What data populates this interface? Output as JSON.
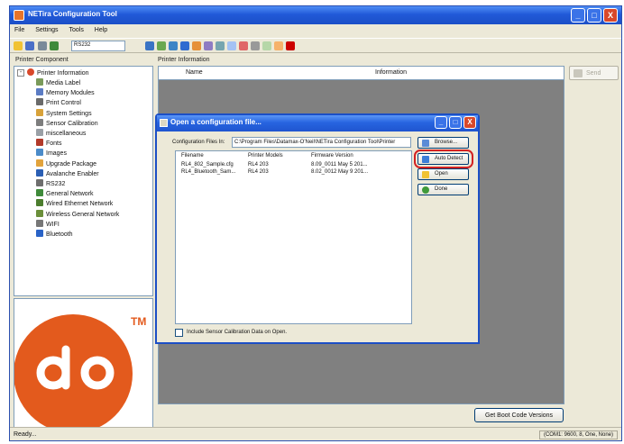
{
  "window": {
    "title": "NETira Configuration Tool",
    "min_glyph": "_",
    "max_glyph": "□",
    "close_glyph": "X"
  },
  "menu": [
    "File",
    "Settings",
    "Tools",
    "Help"
  ],
  "toolbar": {
    "port_value": "RS232"
  },
  "left_panel": {
    "label": "Printer Component",
    "tree_root": "Printer Information",
    "tree_items": [
      {
        "label": "Media Label",
        "icon": "media-label-icon",
        "color": "#7a9a5a"
      },
      {
        "label": "Memory Modules",
        "icon": "memory-icon",
        "color": "#5b7cc4"
      },
      {
        "label": "Print Control",
        "icon": "print-control-icon",
        "color": "#6a6a6a"
      },
      {
        "label": "System Settings",
        "icon": "wrench-icon",
        "color": "#d8a23a"
      },
      {
        "label": "Sensor Calibration",
        "icon": "sensor-icon",
        "color": "#7d7d7d"
      },
      {
        "label": "miscellaneous",
        "icon": "misc-icon",
        "color": "#9aa0a6"
      },
      {
        "label": "Fonts",
        "icon": "font-icon",
        "color": "#b23a2a"
      },
      {
        "label": "Images",
        "icon": "image-icon",
        "color": "#4b8bc9"
      },
      {
        "label": "Upgrade Package",
        "icon": "package-icon",
        "color": "#e2a33c"
      },
      {
        "label": "Avalanche Enabler",
        "icon": "avalanche-icon",
        "color": "#2b5fb4"
      },
      {
        "label": "RS232",
        "icon": "serial-icon",
        "color": "#6e6e6e"
      },
      {
        "label": "General Network",
        "icon": "network-icon",
        "color": "#3f8a3a"
      },
      {
        "label": "Wired Ethernet Network",
        "icon": "ethernet-icon",
        "color": "#4c7d2e"
      },
      {
        "label": "Wireless General Network",
        "icon": "wireless-icon",
        "color": "#6b8f3a"
      },
      {
        "label": "WIFI",
        "icon": "wifi-icon",
        "color": "#777777"
      },
      {
        "label": "Bluetooth",
        "icon": "bluetooth-icon",
        "color": "#2a63c7"
      }
    ],
    "logo_tm": "TM",
    "logo_color": "#e35a1d"
  },
  "right_panel": {
    "label": "Printer Information",
    "col_name": "Name",
    "col_info": "Information",
    "send_label": "Send",
    "boot_code_label": "Get Boot Code Versions"
  },
  "dialog": {
    "title": "Open a configuration file...",
    "files_in_label": "Configuration Files In:",
    "path": "C:\\Program Files\\Datamax-O'Neil\\NETira Configuration Tool\\Printer",
    "columns": [
      "Filename",
      "Printer Models",
      "Firmware Version"
    ],
    "rows": [
      [
        "RL4_802_Sample.cfg",
        "RL4 203",
        "8.09_0011 May 5 201..."
      ],
      [
        "RL4_Bluetooth_Sam...",
        "RL4 203",
        "8.02_0012 May 9 201..."
      ]
    ],
    "browse_label": "Browse...",
    "auto_detect_label": "Auto Detect",
    "open_label": "Open",
    "done_label": "Done",
    "checkbox_label": "Include Sensor Calibration Data on Open."
  },
  "status": {
    "left": "Ready...",
    "right": "(COM1: 9600, 8, One, None)"
  }
}
